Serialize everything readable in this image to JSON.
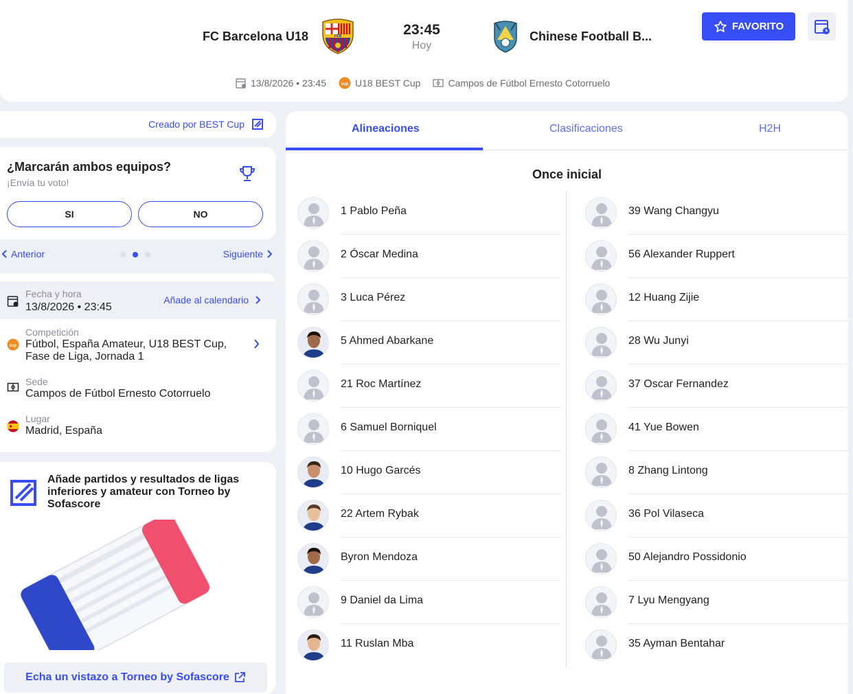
{
  "header": {
    "home_team": "FC Barcelona U18",
    "away_team": "Chinese Football B...",
    "time": "23:45",
    "day": "Hoy",
    "favorite_label": "FAVORITO",
    "meta": {
      "datetime": "13/8/2026 • 23:45",
      "competition": "U18 BEST Cup",
      "venue": "Campos de Fútbol Ernesto Cotorruelo"
    }
  },
  "left": {
    "created_by": "Creado por BEST Cup",
    "vote": {
      "question": "¿Marcarán ambos equipos?",
      "subtitle": "¡Envía tu voto!",
      "yes": "SI",
      "no": "NO"
    },
    "pager": {
      "prev": "Anterior",
      "next": "Siguiente"
    },
    "info": {
      "date_label": "Fecha y hora",
      "date_value": "13/8/2026  •  23:45",
      "add_calendar": "Añade al calendario",
      "comp_label": "Competición",
      "comp_value_1": "Fútbol, España Amateur, U18 BEST Cup,",
      "comp_value_2": "Fase de Liga, Jornada 1",
      "venue_label": "Sede",
      "venue_value": "Campos de Fútbol Ernesto Cotorruelo",
      "place_label": "Lugar",
      "place_value": "Madrid, España"
    },
    "promo": {
      "text": "Añade partidos y resultados de ligas inferiores y amateur con Torneo by Sofascore",
      "button": "Echa un vistazo a Torneo by Sofascore"
    }
  },
  "lineups": {
    "tabs": [
      "Alineaciones",
      "Clasificaciones",
      "H2H"
    ],
    "heading": "Once inicial",
    "home": [
      "1 Pablo Peña",
      "2 Óscar Medina",
      "3 Luca Pérez",
      "5 Ahmed Abarkane",
      "21 Roc Martínez",
      "6 Samuel Borniquel",
      "10 Hugo Garcés",
      "22 Artem Rybak",
      "Byron Mendoza",
      "9 Daniel da Lima",
      "11 Ruslan Mba"
    ],
    "away": [
      "39 Wang Changyu",
      "56 Alexander Ruppert",
      "12 Huang Zijie",
      "28 Wu Junyi",
      "37 Oscar Fernandez",
      "41 Yue Bowen",
      "8 Zhang Lintong",
      "36 Pol Vilaseca",
      "50 Alejandro Possidonio",
      "7 Lyu Mengyang",
      "35 Ayman Bentahar"
    ],
    "home_photo": [
      false,
      false,
      false,
      true,
      false,
      false,
      true,
      true,
      true,
      false,
      true
    ],
    "away_photo": [
      false,
      false,
      false,
      false,
      false,
      false,
      false,
      false,
      false,
      false,
      false
    ]
  },
  "colors": {
    "accent": "#374df5",
    "text": "#222226",
    "muted": "#8c8c96"
  }
}
